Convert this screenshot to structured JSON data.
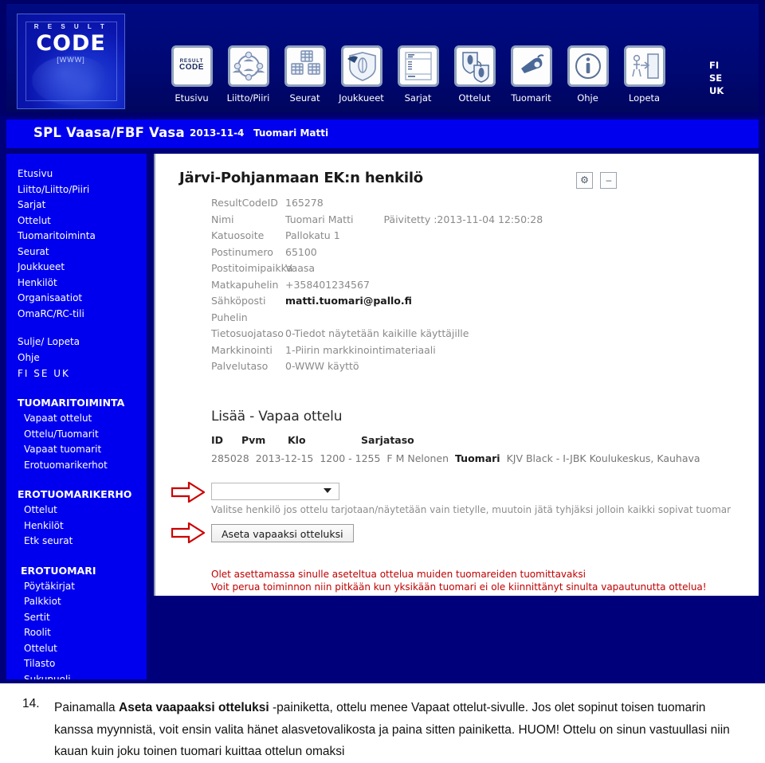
{
  "header": {
    "logo": {
      "top": "R E S U L T",
      "main": "CODE",
      "sub": "[WWW]"
    },
    "nav": [
      {
        "label": "Etusivu",
        "icon": "resultcode-logo-icon"
      },
      {
        "label": "Liitto/Piiri",
        "icon": "network-people-icon"
      },
      {
        "label": "Seurat",
        "icon": "clubs-group-icon"
      },
      {
        "label": "Joukkueet",
        "icon": "team-shield-icon"
      },
      {
        "label": "Sarjat",
        "icon": "series-table-icon"
      },
      {
        "label": "Ottelut",
        "icon": "match-shields-icon"
      },
      {
        "label": "Tuomarit",
        "icon": "whistle-icon"
      },
      {
        "label": "Ohje",
        "icon": "info-circle-icon"
      },
      {
        "label": "Lopeta",
        "icon": "exit-door-icon"
      }
    ],
    "languages": [
      "FI",
      "SE",
      "UK"
    ]
  },
  "titlebar": {
    "organization": "SPL Vaasa/FBF Vasa",
    "date": "2013-11-4",
    "user": "Tuomari Matti"
  },
  "sidebar": {
    "main_links": [
      "Etusivu",
      "Liitto/Liitto/Piiri",
      "Sarjat",
      "Ottelut",
      "Tuomaritoiminta",
      "Seurat",
      "Joukkueet",
      "Henkilöt",
      "Organisaatiot",
      "OmaRC/RC-tili"
    ],
    "util_links": [
      "Sulje/ Lopeta",
      "Ohje"
    ],
    "languages": "FI  SE  UK",
    "groups": [
      {
        "heading": "TUOMARITOIMINTA",
        "items": [
          "Vapaat ottelut",
          "Ottelu/Tuomarit",
          "Vapaat tuomarit",
          "Erotuomarikerhot"
        ]
      },
      {
        "heading": "EROTUOMARIKERHO",
        "items": [
          "Ottelut",
          "Henkilöt",
          "Etk seurat"
        ]
      },
      {
        "heading": "EROTUOMARI",
        "items": [
          "Pöytäkirjat",
          "Palkkiot",
          "Sertit",
          "Roolit",
          "Ottelut",
          "Tilasto",
          "Sukupuoli"
        ]
      }
    ]
  },
  "panel": {
    "title": "Järvi-Pohjanmaan EK:n henkilö",
    "tools": [
      {
        "name": "settings-gear-button",
        "glyph": "⚙"
      },
      {
        "name": "minimize-button",
        "glyph": "–"
      }
    ],
    "details": [
      {
        "label": "ResultCodeID",
        "value": "165278",
        "bold": false,
        "extra": ""
      },
      {
        "label": "Nimi",
        "value": "Tuomari Matti",
        "bold": false,
        "extra": "Päivitetty :2013-11-04 12:50:28"
      },
      {
        "label": "Katuosoite",
        "value": "Pallokatu 1",
        "bold": false,
        "extra": ""
      },
      {
        "label": "Postinumero",
        "value": "65100",
        "bold": false,
        "extra": ""
      },
      {
        "label": "Postitoimipaikka",
        "value": "Vaasa",
        "bold": false,
        "extra": ""
      },
      {
        "label": "Matkapuhelin",
        "value": "+358401234567",
        "bold": false,
        "extra": ""
      },
      {
        "label": "Sähköposti",
        "value": "matti.tuomari@pallo.fi",
        "bold": true,
        "extra": ""
      },
      {
        "label": "Puhelin",
        "value": "",
        "bold": false,
        "extra": ""
      },
      {
        "label": "Tietosuojataso",
        "value": "0-Tiedot näytetään kaikille käyttäjille",
        "bold": false,
        "extra": ""
      },
      {
        "label": "Markkinointi",
        "value": "1-Piirin markkinointimateriaali",
        "bold": false,
        "extra": ""
      },
      {
        "label": "Palvelutaso",
        "value": "0-WWW käyttö",
        "bold": false,
        "extra": ""
      }
    ]
  },
  "add_match": {
    "title": "Lisää - Vapaa ottelu",
    "columns": {
      "id": "ID",
      "pvm": "Pvm",
      "klo": "Klo",
      "sarjataso": "Sarjataso"
    },
    "row": {
      "id": "285028",
      "pvm": "2013-12-15",
      "klo": "1200 - 1255",
      "sarjataso": "F M Nelonen",
      "role": "Tuomari",
      "teams": "KJV Black - I-JBK Koulukeskus, Kauhava"
    },
    "select_value": "",
    "select_placeholder": "",
    "hint": "Valitse henkilö jos ottelu tarjotaan/näytetään vain tietylle, muutoin jätä tyhjäksi jolloin kaikki sopivat tuomar",
    "submit_label": "Aseta vapaaksi otteluksi",
    "warning_line1": "Olet asettamassa sinulle aseteltua ottelua muiden tuomareiden tuomittavaksi",
    "warning_line2": "Voit perua toiminnon niin pitkään kun yksikään tuomari ei ole kiinnittänyt sinulta vapautunutta ottelua!"
  },
  "caption": {
    "number": "14.",
    "part1": "Painamalla ",
    "bold1": "Aseta vaapaaksi otteluksi",
    "part2": " -painiketta, ottelu menee Vapaat ottelut-sivulle. Jos olet sopinut toisen tuomarin kanssa myynnistä, voit ensin valita hänet alasvetovalikosta ja paina sitten painiketta. HUOM! Ottelu on sinun vastuullasi niin kauan kuin joku toinen tuomari kuittaa ottelun omaksi"
  },
  "colors": {
    "banner_bg": "#000069",
    "app_bg": "#00007a",
    "accent_blue": "#0000ee",
    "panel_bg": "#ffffff",
    "warning_red": "#c00000",
    "arrow_red": "#cc0000"
  }
}
